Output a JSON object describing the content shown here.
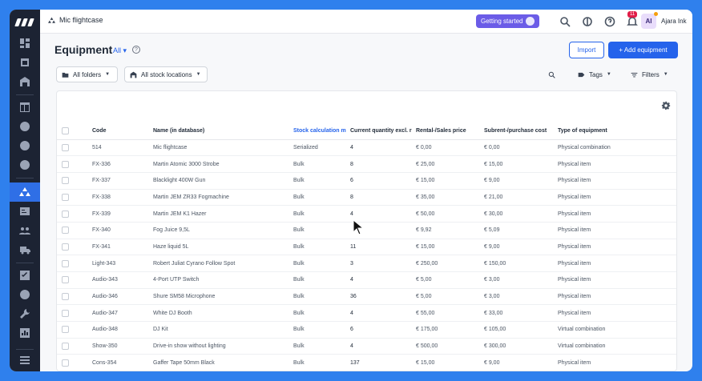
{
  "topbar": {
    "breadcrumb": "Mic flightcase",
    "getting_started": "Getting started",
    "notification_count": "11",
    "avatar_initials": "AI",
    "org_name": "Ajara Ink"
  },
  "page": {
    "title": "Equipment",
    "filter_all": "All ▾",
    "import_label": "Import",
    "add_label": "+ Add equipment"
  },
  "toolbar": {
    "all_folders": "All folders",
    "all_stock_locations": "All stock locations",
    "tags": "Tags",
    "filters": "Filters"
  },
  "table": {
    "headers": [
      "Code",
      "Name (in database)",
      "Stock calculation m",
      "Current quantity excl. r",
      "Rental-/Sales price",
      "Subrent-/purchase cost",
      "Type of equipment"
    ],
    "rows": [
      {
        "code": "514",
        "name": "Mic flightcase",
        "stock": "Serialized",
        "qty": "4",
        "price": "€ 0,00",
        "cost": "€ 0,00",
        "type": "Physical combination"
      },
      {
        "code": "FX-336",
        "name": "Martin Atomic 3000 Strobe",
        "stock": "Bulk",
        "qty": "8",
        "price": "€ 25,00",
        "cost": "€ 15,00",
        "type": "Physical item"
      },
      {
        "code": "FX-337",
        "name": "Blacklight 400W Gun",
        "stock": "Bulk",
        "qty": "6",
        "price": "€ 15,00",
        "cost": "€ 9,00",
        "type": "Physical item"
      },
      {
        "code": "FX-338",
        "name": "Martin JEM ZR33 Fogmachine",
        "stock": "Bulk",
        "qty": "8",
        "price": "€ 35,00",
        "cost": "€ 21,00",
        "type": "Physical item"
      },
      {
        "code": "FX-339",
        "name": "Martin JEM K1 Hazer",
        "stock": "Bulk",
        "qty": "4",
        "price": "€ 50,00",
        "cost": "€ 30,00",
        "type": "Physical item"
      },
      {
        "code": "FX-340",
        "name": "Fog Juice 9,5L",
        "stock": "Bulk",
        "qty": "",
        "price": "€ 9,92",
        "cost": "€ 5,09",
        "type": "Physical item"
      },
      {
        "code": "FX-341",
        "name": "Haze liquid 5L",
        "stock": "Bulk",
        "qty": "11",
        "price": "€ 15,00",
        "cost": "€ 9,00",
        "type": "Physical item"
      },
      {
        "code": "Light-343",
        "name": "Robert Juliat Cyrano Follow Spot",
        "stock": "Bulk",
        "qty": "3",
        "price": "€ 250,00",
        "cost": "€ 150,00",
        "type": "Physical item"
      },
      {
        "code": "Audio-343",
        "name": "4-Port UTP Switch",
        "stock": "Bulk",
        "qty": "4",
        "price": "€ 5,00",
        "cost": "€ 3,00",
        "type": "Physical item"
      },
      {
        "code": "Audio-346",
        "name": "Shure SM58 Microphone",
        "stock": "Bulk",
        "qty": "36",
        "price": "€ 5,00",
        "cost": "€ 3,00",
        "type": "Physical item"
      },
      {
        "code": "Audio-347",
        "name": "White DJ Booth",
        "stock": "Bulk",
        "qty": "4",
        "price": "€ 55,00",
        "cost": "€ 33,00",
        "type": "Physical item"
      },
      {
        "code": "Audio-348",
        "name": "DJ Kit",
        "stock": "Bulk",
        "qty": "6",
        "price": "€ 175,00",
        "cost": "€ 105,00",
        "type": "Virtual combination"
      },
      {
        "code": "Show-350",
        "name": "Drive-in show without lighting",
        "stock": "Bulk",
        "qty": "4",
        "price": "€ 500,00",
        "cost": "€ 300,00",
        "type": "Virtual combination"
      },
      {
        "code": "Cons-354",
        "name": "Gaffer Tape 50mm Black",
        "stock": "Bulk",
        "qty": "137",
        "price": "€ 15,00",
        "cost": "€ 9,00",
        "type": "Physical item"
      }
    ]
  }
}
